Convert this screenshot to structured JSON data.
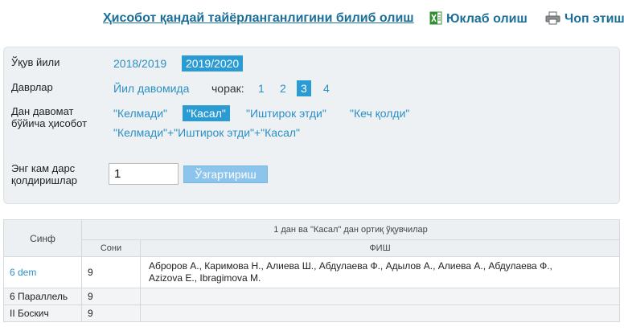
{
  "toolbar": {
    "report_link": "Ҳисобот қандай тайёрланганлигини билиб олиш",
    "download": "Юклаб олиш",
    "print": "Чоп этиш"
  },
  "filters": {
    "year_label": "Ўқув йили",
    "years": [
      "2018/2019",
      "2019/2020"
    ],
    "selected_year": "2019/2020",
    "period_label": "Даврлар",
    "whole_year": "Йил давомида",
    "quarter_label": "чорак:",
    "quarters": [
      "1",
      "2",
      "3",
      "4"
    ],
    "selected_quarter": "3",
    "report_label_1": "Дан давомат",
    "report_label_2": "бўйича ҳисобот",
    "types": [
      "\"Келмади\"",
      "\"Касал\"",
      "\"Иштирок этди\"",
      "\"Кеч қолди\""
    ],
    "selected_type": "\"Касал\"",
    "combined_type": "\"Келмади\"+\"Иштирок этди\"+\"Касал\"",
    "min_label_1": "Энг кам дарс",
    "min_label_2": "қолдиришлар",
    "min_value": "1",
    "apply_button": "Ўзгартириш"
  },
  "table": {
    "col_class": "Синф",
    "group_header": "1 дан ва \"Касал\" дан ортиқ ўқувчилар",
    "col_count": "Сони",
    "col_names": "ФИШ",
    "rows": [
      {
        "class": "6 dem",
        "count": "9",
        "names_1": "Аброров А., Каримова Н., Алиева Ш., Абдулаева Ф., Адылов А., Алиева А., Абдулаева Ф.,",
        "names_2": "Azizova E., Ibragimova M."
      },
      {
        "class": "6 Параллель",
        "count": "9",
        "names_1": "",
        "names_2": ""
      },
      {
        "class": "II Боскич",
        "count": "9",
        "names_1": "",
        "names_2": ""
      }
    ]
  },
  "colors": {
    "link": "#2b8fc4",
    "selected_bg": "#2b9bd4",
    "panel_bg": "#eef1f4"
  },
  "icons": {
    "download": "excel-icon",
    "print": "printer-icon"
  }
}
